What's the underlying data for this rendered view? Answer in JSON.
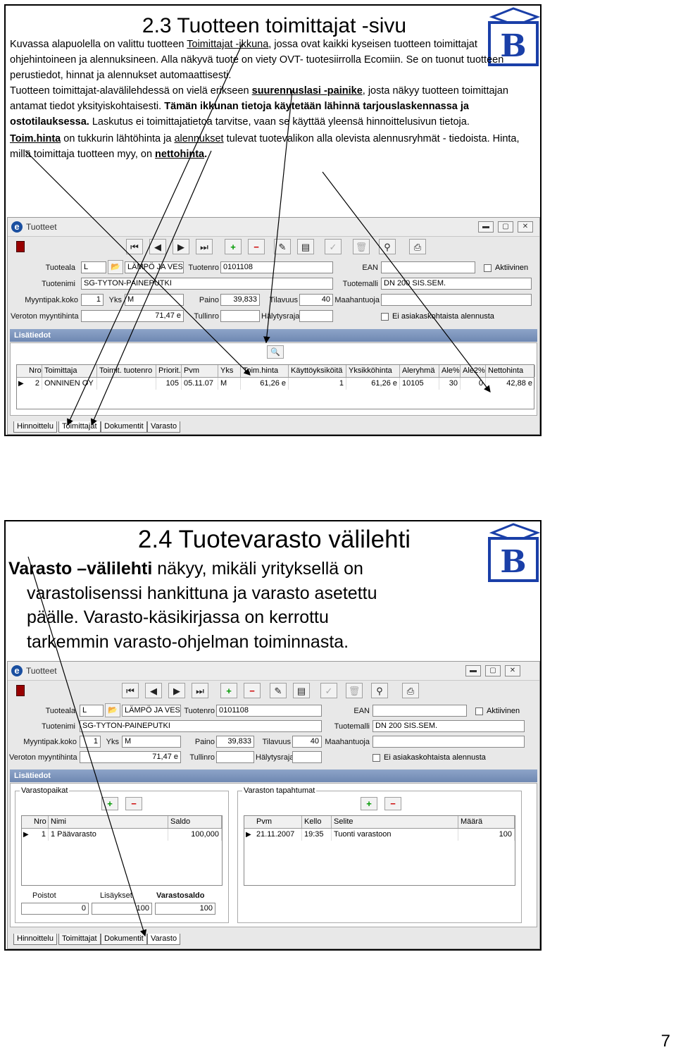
{
  "slide1": {
    "title": "2.3 Tuotteen toimittajat -sivu",
    "p1": {
      "before": "Kuvassa alapuolella on valittu tuotteen ",
      "link": "Toimittajat -ikkuna",
      "after": ", jossa ovat  kaikki kyseisen tuotteen toimittajat ohjehintoineen ja alennuksineen. Alla näkyvä tuote on viety OVT- tuotesiirrolla Ecomiin.  Se on tuonut tuotteen perustiedot, hinnat ja alennukset automaattisesti."
    },
    "p2": {
      "before": "Tuotteen toimittajat-alavälilehdessä on vielä erikseen ",
      "link": "suurennuslasi -painike",
      "mid": ", josta näkyy tuotteen toimittajan antamat tiedot yksityiskohtaisesti. ",
      "bold": "Tämän ikkunan tietoja käytetään lähinnä tarjouslaskennassa ja ostotilauksessa.",
      "after": " Laskutus ei toimittajatietoa tarvitse, vaan se käyttää yleensä hinnoittelusivun tietoja."
    },
    "p3": {
      "link1": "Toim.hinta",
      "a": " on tukkurin lähtöhinta ja ",
      "link2": "alennukset",
      "b": " tulevat tuotevalikon alla olevista alennusryhmät - tiedoista. Hinta, millä toimittaja tuotteen myy, on ",
      "link3": "nettohinta",
      "c": "."
    }
  },
  "slide2": {
    "title": "2.4 Tuotevarasto välilehti",
    "line1_bold": "Varasto –välilehti",
    "line1_rest": " näkyy, mikäli yrityksellä on",
    "line2": "varastolisenssi hankittuna ja varasto asetettu",
    "line3": "päälle. Varasto-käsikirjassa on kerrottu",
    "line4": "tarkemmin varasto-ohjelman toiminnasta."
  },
  "logo_letter": "B",
  "window": {
    "title": "Tuotteet",
    "app_icon": "e",
    "toolbar_icons": [
      "exit-icon",
      "first-icon",
      "prev-icon",
      "next-icon",
      "last-icon",
      "add-icon",
      "delete-icon",
      "edit-icon",
      "print-preview-icon",
      "confirm-icon",
      "trash-icon",
      "link-icon",
      "printer-icon"
    ],
    "labels": {
      "tuoteala": "Tuoteala",
      "tuotenro": "Tuotenro",
      "ean": "EAN",
      "aktiivinen": "Aktiivinen",
      "tuotenimi": "Tuotenimi",
      "tuotemalli": "Tuotemalli",
      "myyntipak": "Myyntipak.koko",
      "yks": "Yks",
      "paino": "Paino",
      "tilavuus": "Tilavuus",
      "maahantuoja": "Maahantuoja",
      "veroton": "Veroton myyntihinta",
      "tullinro": "Tullinro",
      "halytysraja": "Hälytysraja",
      "ei_alennusta": "Ei asiakaskohtaista alennusta",
      "lisatiedot": "Lisätiedot"
    },
    "values": {
      "tuoteala": "L",
      "tuoteala_name": "LÄMPÖ JA VESI",
      "tuotenro": "0101108",
      "ean": "",
      "tuotenimi": "SG-TYTON-PAINEPUTKI",
      "tuotemalli": "DN 200 SIS.SEM.",
      "myyntipak": "1",
      "yks": "M",
      "paino": "39,833",
      "tilavuus": "40",
      "maahantuoja": "",
      "veroton": "71,47 e",
      "tullinro": "",
      "halytysraja": ""
    },
    "window_buttons": {
      "minimize": "▬",
      "maximize": "▢",
      "close": "✕"
    }
  },
  "win1": {
    "values_override": {
      "tuotenimi": "SG-TYTON-PAINEPUTKI",
      "tuotemalli": "DN 200 SIS.SEM.",
      "veroton": "71,47 e"
    },
    "grid": {
      "headers": [
        "Nro",
        "Toimittaja",
        "Toimit. tuotenro",
        "Priorit.",
        "Pvm",
        "Yks",
        "Toim.hinta",
        "Käyttöyksiköitä",
        "Yksikköhinta",
        "Aleryhmä",
        "Ale%",
        "Ale2%",
        "Nettohinta"
      ],
      "row": [
        "2",
        "ONNINEN OY",
        "",
        "105",
        "05.11.07",
        "M",
        "61,26 e",
        "1",
        "61,26 e",
        "10105",
        "30",
        "0",
        "42,88 e"
      ]
    },
    "tabs": [
      "Hinnoittelu",
      "Toimittajat",
      "Dokumentit",
      "Varasto"
    ],
    "active_tab": 1
  },
  "win2": {
    "frame_left": "Varastopaikat",
    "frame_right": "Varaston tapahtumat",
    "left_grid": {
      "headers": [
        "Nro",
        "Nimi",
        "Saldo"
      ],
      "row": [
        "1",
        "1 Päävarasto",
        "100,000"
      ]
    },
    "right_grid": {
      "headers": [
        "Pvm",
        "Kello",
        "Selite",
        "Määrä"
      ],
      "row": [
        "21.11.2007",
        "19:35",
        "Tuonti varastoon",
        "100"
      ]
    },
    "totals": {
      "poistot_label": "Poistot",
      "poistot": "0",
      "lisaykset_label": "Lisäykset",
      "lisaykset": "100",
      "saldo_label": "Varastosaldo",
      "saldo": "100"
    },
    "tabs": [
      "Hinnoittelu",
      "Toimittajat",
      "Dokumentit",
      "Varasto"
    ],
    "active_tab": 3
  },
  "page_number": "7",
  "colors": {
    "accent": "#1a3fa8",
    "bar": "#7a92ba",
    "annotation": "#000000"
  }
}
